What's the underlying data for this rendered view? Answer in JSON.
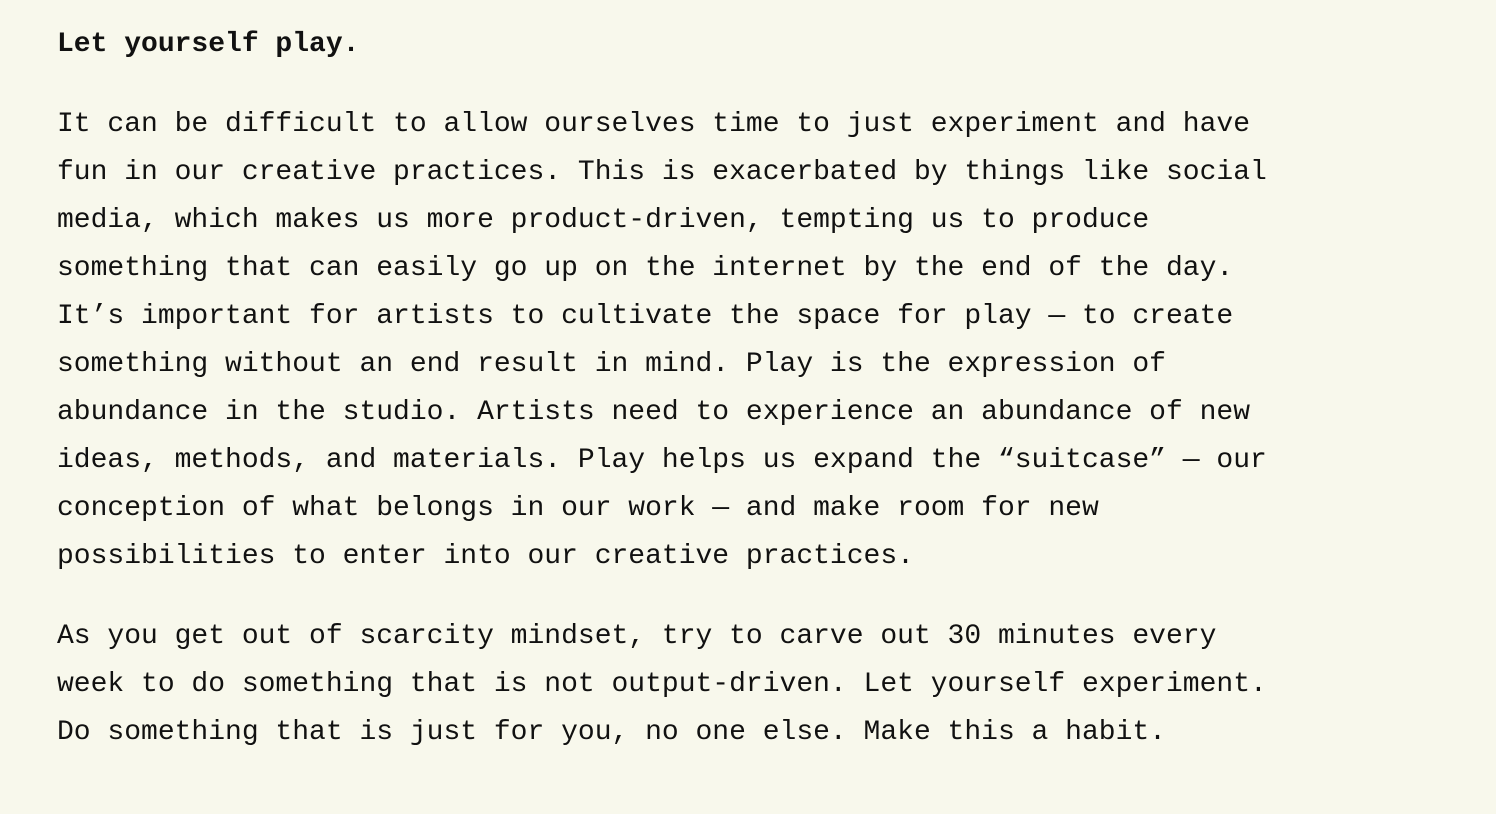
{
  "article": {
    "heading": "Let yourself play.",
    "paragraphs": [
      {
        "lines": [
          "It can be difficult to allow ourselves time to just experiment and have",
          "fun in our creative practices. This is exacerbated by things like social",
          "media, which makes us more product-driven, tempting us to produce",
          "something that can easily go up on the internet by the end of the day.",
          "It’s important for artists to cultivate the space for play — to create",
          "something without an end result in mind. Play is the expression of",
          "abundance in the studio. Artists need to experience an abundance of new",
          "ideas, methods, and materials. Play helps us expand the “suitcase” — our",
          "conception of what belongs in our work — and make room for new",
          "possibilities to enter into our creative practices."
        ]
      },
      {
        "lines": [
          "As you get out of scarcity mindset, try to carve out 30 minutes every",
          "week to do something that is not output-driven. Let yourself experiment.",
          "Do something that is just for you, no one else. Make this a habit."
        ]
      }
    ]
  },
  "colors": {
    "background": "#f8f8ec",
    "text": "#111111"
  }
}
